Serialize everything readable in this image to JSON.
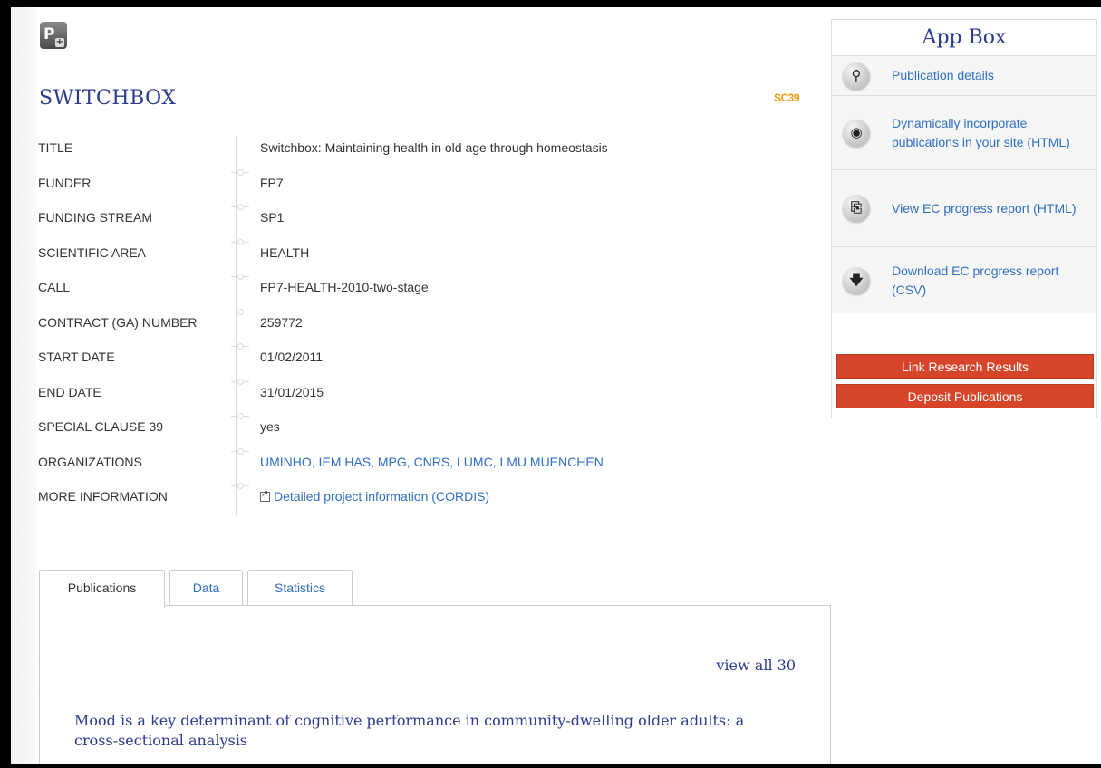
{
  "logo": {
    "text": "P",
    "badge": "+"
  },
  "project": {
    "acronym": "SWITCHBOX",
    "badge": "SC39"
  },
  "details": [
    {
      "label": "TITLE",
      "value": "Switchbox: Maintaining health in old age through homeostasis"
    },
    {
      "label": "FUNDER",
      "value": "FP7"
    },
    {
      "label": "FUNDING STREAM",
      "value": "SP1"
    },
    {
      "label": "SCIENTIFIC AREA",
      "value": "HEALTH"
    },
    {
      "label": "CALL",
      "value": "FP7-HEALTH-2010-two-stage"
    },
    {
      "label": "CONTRACT (GA) NUMBER",
      "value": "259772"
    },
    {
      "label": "START DATE",
      "value": "01/02/2011"
    },
    {
      "label": "END DATE",
      "value": "31/01/2015"
    },
    {
      "label": "SPECIAL CLAUSE 39",
      "value": "yes"
    },
    {
      "label": "ORGANIZATIONS",
      "value": "UMINHO, IEM HAS, MPG, CNRS, LUMC, LMU MUENCHEN"
    },
    {
      "label": "MORE INFORMATION",
      "value": "Detailed project information (CORDIS)"
    }
  ],
  "appbox": {
    "title": "App Box",
    "items": [
      {
        "label": "Publication details",
        "icon": "magnifier-icon"
      },
      {
        "label": "Dynamically incorporate publications in your site (HTML)",
        "icon": "globe-icon"
      },
      {
        "label": "View EC progress report (HTML)",
        "icon": "document-add-icon"
      },
      {
        "label": "Download EC progress report (CSV)",
        "icon": "download-arrow-icon"
      }
    ],
    "buttons": {
      "link_results": "Link Research Results",
      "deposit": "Deposit Publications"
    }
  },
  "tabs": [
    {
      "label": "Publications",
      "active": true
    },
    {
      "label": "Data",
      "active": false
    },
    {
      "label": "Statistics",
      "active": false
    }
  ],
  "publications": {
    "view_all": "view all 30",
    "first_title": "Mood is a key determinant of cognitive performance in community-dwelling older adults: a cross-sectional analysis"
  },
  "colors": {
    "title_blue": "#2b3a8f",
    "link_blue": "#2f6fc1",
    "badge_orange": "#f39c12",
    "button_red": "#d6452a"
  }
}
